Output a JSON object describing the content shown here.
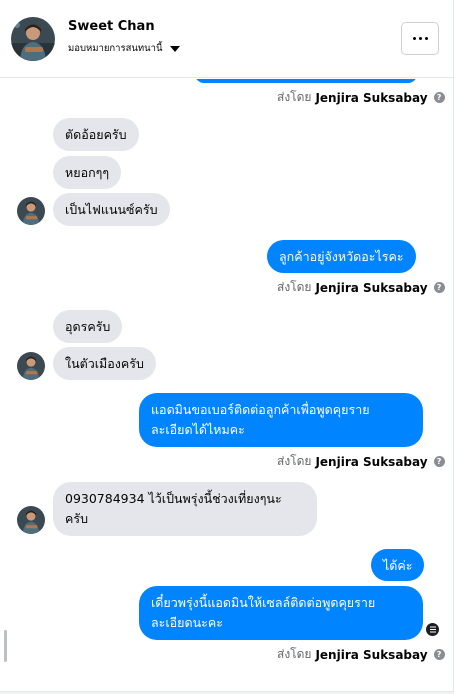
{
  "header": {
    "name": "Sweet Chan",
    "assign_label": "มอบหมายการสนทนานี้",
    "more_label": "..."
  },
  "messages": [
    {
      "text": "ตัดอ้อยครับ"
    },
    {
      "text": "หยอกๆๆ"
    },
    {
      "text": "เป็นไฟแนนซ์ครับ"
    },
    {
      "text": "ลูกค้าอยู่จังหวัดอะไรคะ"
    },
    {
      "text": "อุดรครับ"
    },
    {
      "text": "ในตัวเมืองครับ"
    },
    {
      "text_l1": "แอดมินขอเบอร์ติดต่อลูกค้าเพื่อพูดคุยราย",
      "text_l2": "ละเอียดได้ไหมคะ"
    },
    {
      "text_l1": "0930784934 ไว้เป็นพรุ่งนี้ช่วงเที่ยงๆนะ",
      "text_l2": "ครับ"
    },
    {
      "text": "ได้ค่ะ"
    },
    {
      "text_l1": "เดี๋ยวพรุ่งนี้แอดมินให้เซลล์ติดต่อพูดคุยราย",
      "text_l2": "ละเอียดนะคะ"
    }
  ],
  "sent_by": {
    "prefix": "ส่งโดย",
    "agent": "Jenjira Suksabay",
    "info_icon": "?"
  },
  "colors": {
    "outgoing": "#0084ff",
    "incoming": "#e4e6eb"
  },
  "icons": [
    "chevron-down-icon",
    "more-dots-icon",
    "info-icon",
    "seen-indicator-icon"
  ]
}
